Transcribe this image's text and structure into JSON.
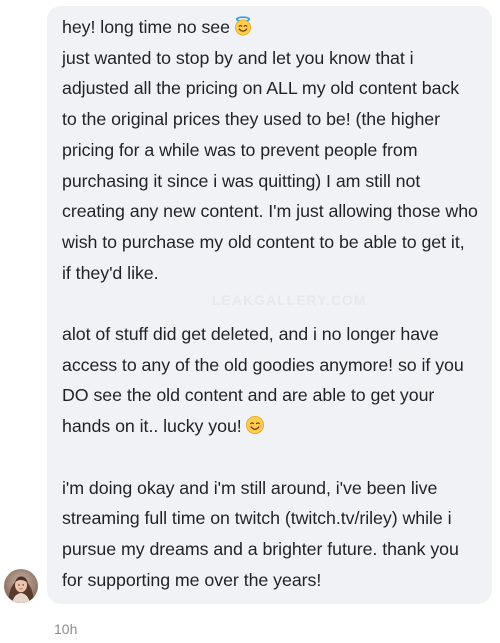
{
  "message": {
    "line_greeting": "hey! long time no see",
    "greeting_emoji": "innocent-smiling-face-with-halo",
    "paragraph1": "just wanted to stop by and let you know that i adjusted all the pricing on ALL my old content back to the original prices they used to be! (the higher pricing for a while was to prevent people from purchasing it since i was quitting) I am still not creating any new content. I'm just allowing those who wish to purchase my old content to be able to get it, if they'd like.",
    "paragraph2": "alot of stuff did get deleted, and i no longer have access to any of the old goodies anymore! so if you DO see the old content and are able to get your hands on it.. lucky you!",
    "paragraph2_emoji": "smiling-face-with-smiling-eyes",
    "paragraph3": "i'm doing okay and i'm still around, i've been live streaming full time on twitch (twitch.tv/riley) while i pursue my dreams and a brighter future. thank you for supporting me over the years!",
    "watermark": "LEAKGALLERY.COM",
    "timestamp": "10h"
  },
  "colors": {
    "bubble_bg": "#f0f2f5",
    "text": "#1f2329",
    "timestamp": "#8a8d91"
  },
  "icons": {
    "emoji_halo": "smiling-face-with-halo-icon",
    "emoji_smile": "smiling-face-icon",
    "avatar": "user-avatar"
  }
}
